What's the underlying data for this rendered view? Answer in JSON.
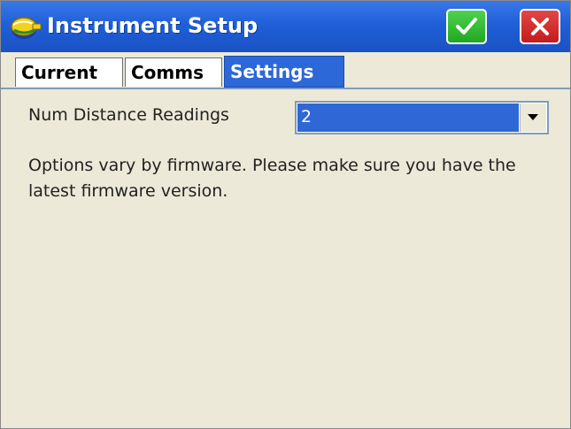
{
  "window": {
    "title": "Instrument Setup",
    "app_icon": "instrument-app-icon",
    "ok_icon": "checkmark-icon",
    "close_icon": "close-icon"
  },
  "tabs": [
    {
      "label": "Current",
      "active": false
    },
    {
      "label": "Comms",
      "active": false
    },
    {
      "label": "Settings",
      "active": true
    }
  ],
  "settings": {
    "num_distance_readings_label": "Num Distance Readings",
    "num_distance_readings_value": "2",
    "info_text": "Options vary by firmware.  Please make sure you have the latest firmware version."
  },
  "colors": {
    "titlebar": "#1f5fd8",
    "ok_button": "#22a722",
    "close_button": "#c41c1c",
    "active_tab": "#2d68d8",
    "background": "#ece9d8"
  }
}
